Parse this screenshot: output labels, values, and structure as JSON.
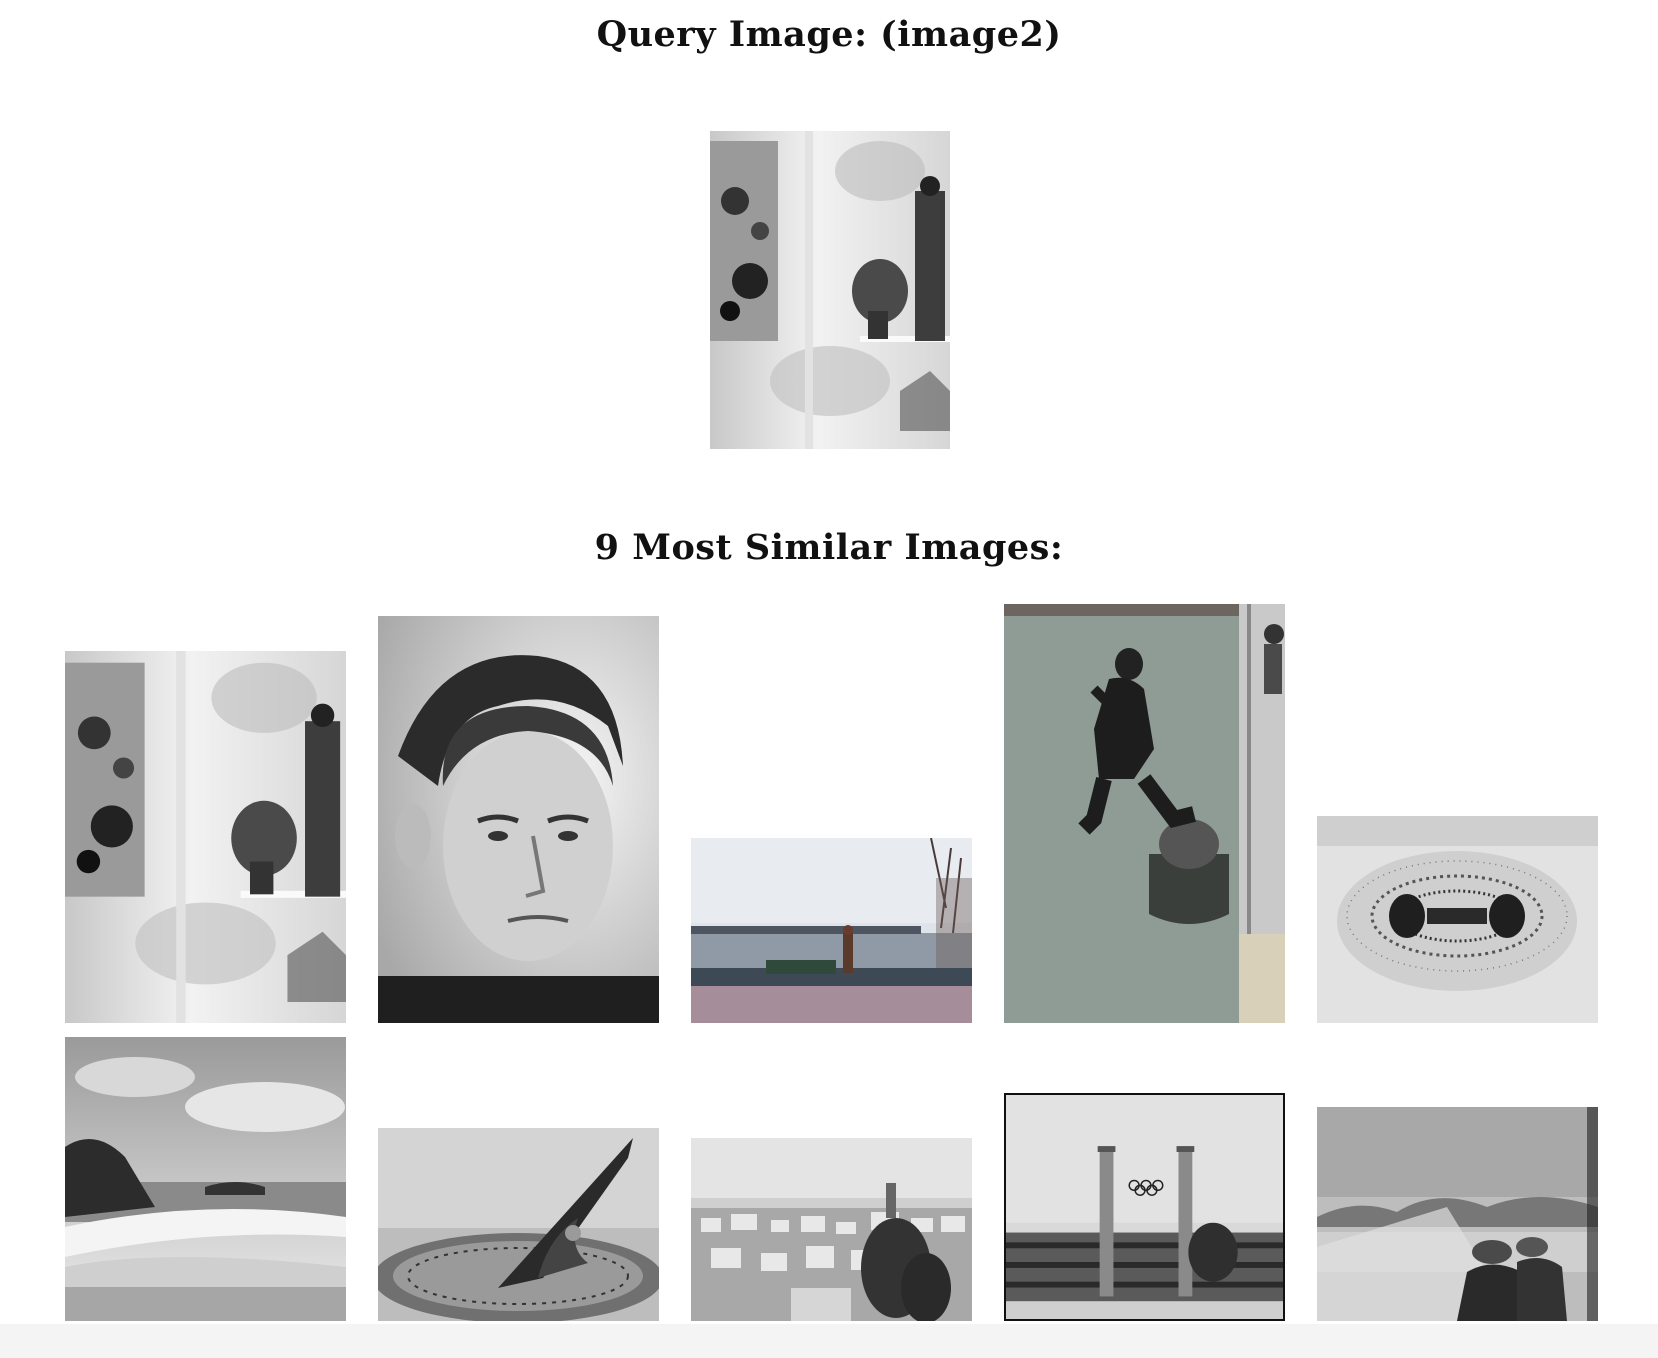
{
  "query_title": "Query Image: (image2)",
  "results_title": "9 Most Similar Images:",
  "query_image": {
    "subject": "wall-painting-with-statue"
  },
  "results": [
    {
      "subject": "wall-painting-with-statue"
    },
    {
      "subject": "portrait-of-man"
    },
    {
      "subject": "lakeside-bench-walker"
    },
    {
      "subject": "diver-jumping-from-boat"
    },
    {
      "subject": "iron-filings-magnetic-field"
    },
    {
      "subject": "beach-waves-rocks"
    },
    {
      "subject": "sundial"
    },
    {
      "subject": "city-rooftops"
    },
    {
      "subject": "olympic-stadium-towers"
    },
    {
      "subject": "old-photo-two-men-boat"
    }
  ]
}
